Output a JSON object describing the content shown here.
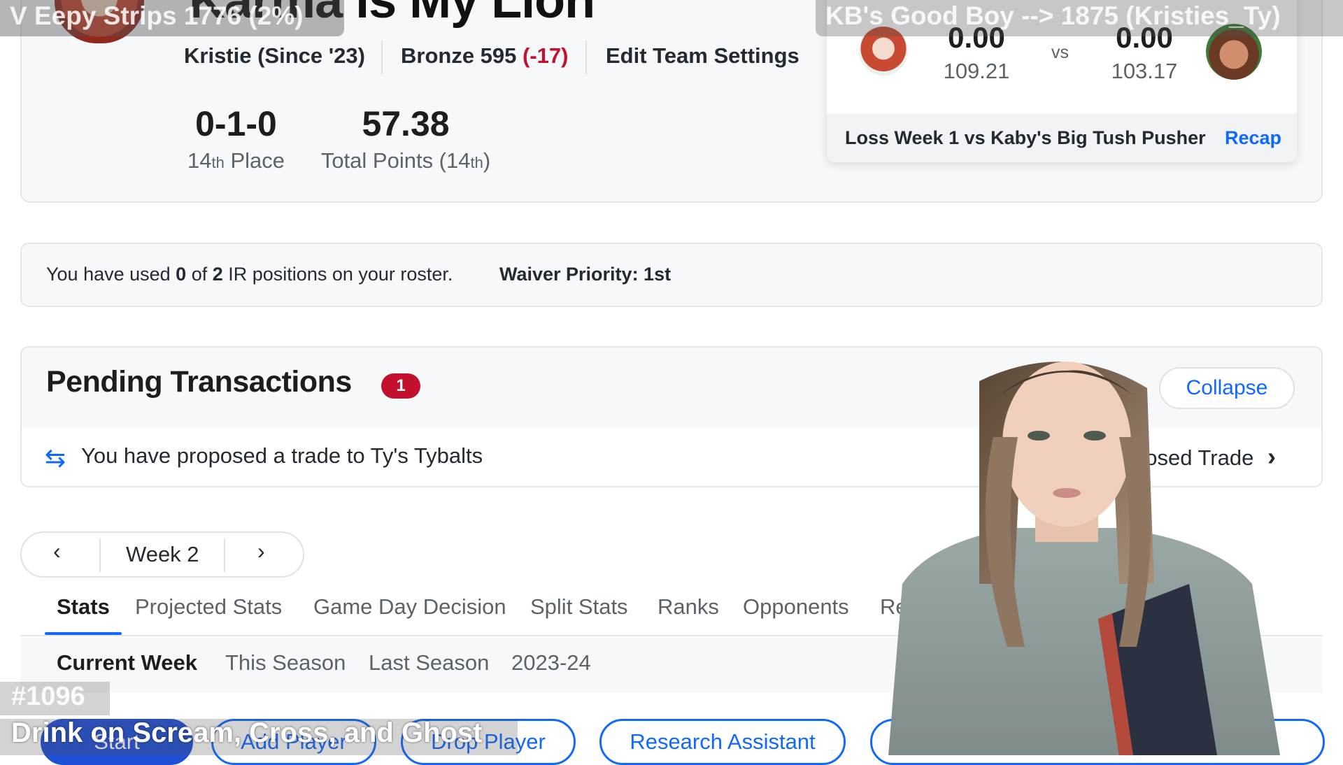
{
  "team": {
    "name": "Karma is My Lion",
    "manager": "Kristie (Since '23)",
    "rank_label": "Bronze 595",
    "rank_change": "(-17)",
    "edit_settings": "Edit Team Settings",
    "record": "0-1-0",
    "place_num": "14",
    "place_suffix": "th",
    "place_word": "Place",
    "total_points": "57.38",
    "total_points_label": "Total Points (",
    "total_points_rank_num": "14",
    "total_points_rank_suffix": "th",
    "total_points_close": ")"
  },
  "matchup": {
    "my_score": "0.00",
    "my_proj": "109.21",
    "vs": "vs",
    "opp_score": "0.00",
    "opp_proj": "103.17",
    "result_text": "Loss Week 1 vs Kaby's Big Tush Pusher",
    "recap": "Recap"
  },
  "overlay": {
    "top_left": "V Eepy Strips 1776 (2%)",
    "top_right": "KB's Good Boy --> 1875 (Kristies_Ty)",
    "bottom_id": "#1096",
    "bottom_text": "Drink on Scream, Cross, and Ghost"
  },
  "ir_bar": {
    "prefix": "You have used ",
    "used": "0",
    "of": " of ",
    "total": "2",
    "suffix": " IR positions on your roster.",
    "waiver": "Waiver Priority: 1st"
  },
  "pending": {
    "title": "Pending Transactions",
    "count": "1",
    "collapse": "Collapse",
    "trade_text": "You have proposed a trade to Ty's Tybalts",
    "view_text": "posed Trade"
  },
  "week": {
    "label": "Week 2",
    "prev": "‹",
    "next": "›"
  },
  "tabs": [
    "Stats",
    "Projected Stats",
    "Game Day Decision",
    "Split Stats",
    "Ranks",
    "Opponents",
    "Rese"
  ],
  "subtabs": [
    "Current Week",
    "This Season",
    "Last Season",
    "2023-24"
  ],
  "buttons": {
    "start": "Start",
    "add_player": "Add Player",
    "drop_player": "Drop Player",
    "research": "Research Assistant"
  },
  "colors": {
    "accent": "#0f69ff",
    "negative": "#c3102f",
    "badge": "#c3102f"
  }
}
